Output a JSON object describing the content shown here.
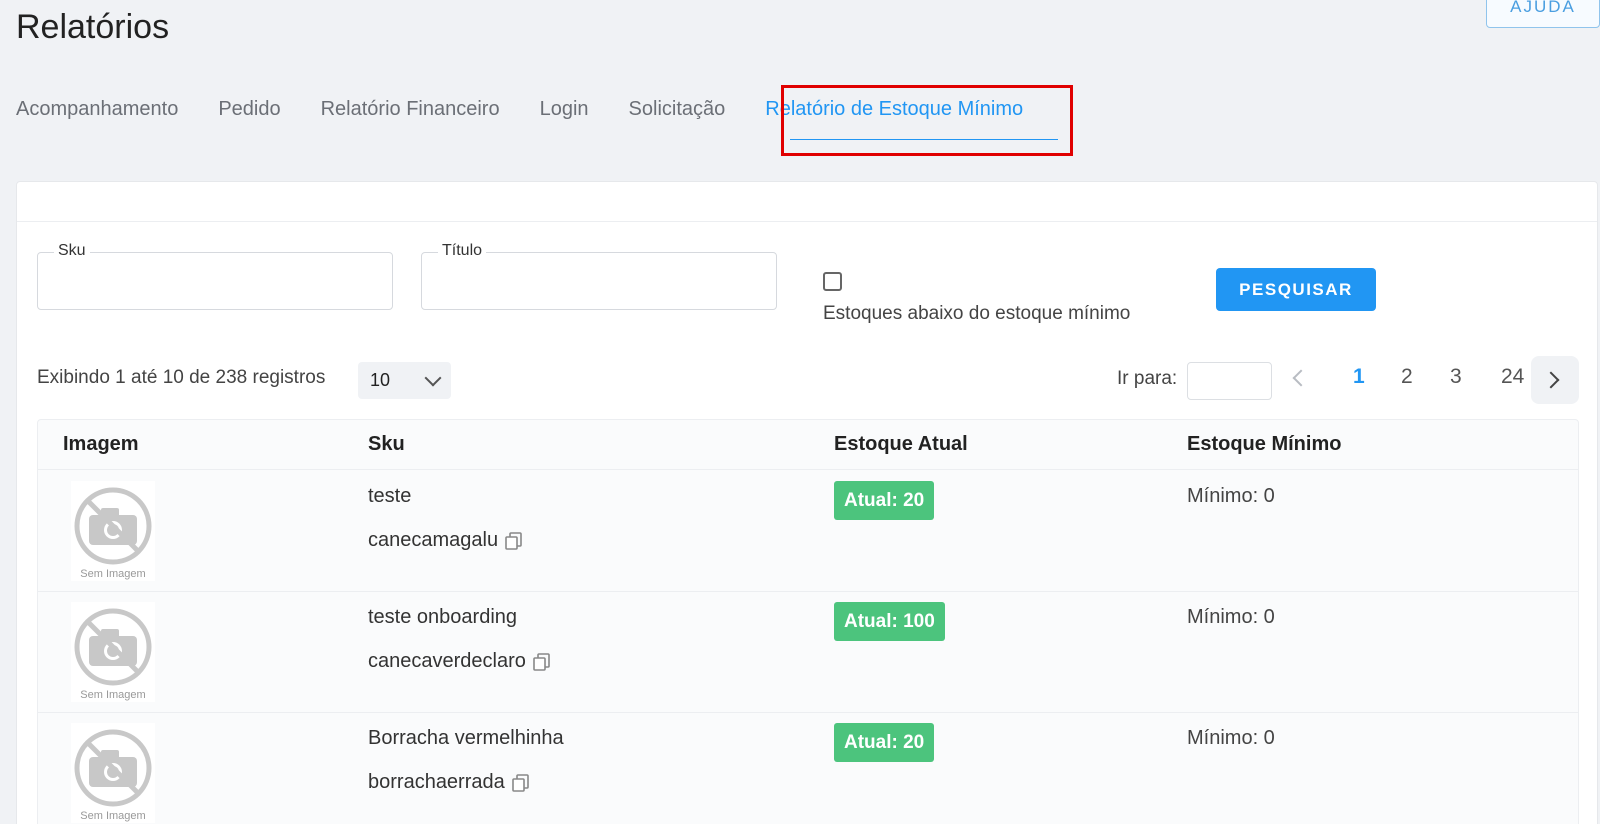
{
  "page": {
    "title": "Relatórios",
    "help_label": "AJUDA"
  },
  "tabs": [
    {
      "label": "Acompanhamento",
      "active": false
    },
    {
      "label": "Pedido",
      "active": false
    },
    {
      "label": "Relatório Financeiro",
      "active": false
    },
    {
      "label": "Login",
      "active": false
    },
    {
      "label": "Solicitação",
      "active": false
    },
    {
      "label": "Relatório de Estoque Mínimo",
      "active": true
    }
  ],
  "filters": {
    "sku_label": "Sku",
    "sku_value": "",
    "title_label": "Título",
    "title_value": "",
    "below_min_label": "Estoques abaixo do estoque mínimo",
    "below_min_checked": false,
    "search_label": "PESQUISAR"
  },
  "listing": {
    "records_info": "Exibindo 1 até 10 de 238 registros",
    "page_size": "10",
    "goto_label": "Ir para:",
    "goto_value": "",
    "pages": [
      "1",
      "2",
      "3",
      "24"
    ],
    "current_page": "1"
  },
  "table": {
    "headers": {
      "image": "Imagem",
      "sku": "Sku",
      "current_stock": "Estoque Atual",
      "min_stock": "Estoque Mínimo"
    },
    "placeholder_image_label": "Sem Imagem",
    "rows": [
      {
        "title": "teste",
        "sku": "canecamagalu",
        "current": "Atual: 20",
        "minimum": "Mínimo: 0"
      },
      {
        "title": "teste onboarding",
        "sku": "canecaverdeclaro",
        "current": "Atual: 100",
        "minimum": "Mínimo: 0"
      },
      {
        "title": "Borracha vermelhinha",
        "sku": "borrachaerrada",
        "current": "Atual: 20",
        "minimum": "Mínimo: 0"
      }
    ]
  },
  "colors": {
    "accent": "#2196f3",
    "badge_green": "#4cc47d",
    "highlight_red": "#e00000"
  }
}
